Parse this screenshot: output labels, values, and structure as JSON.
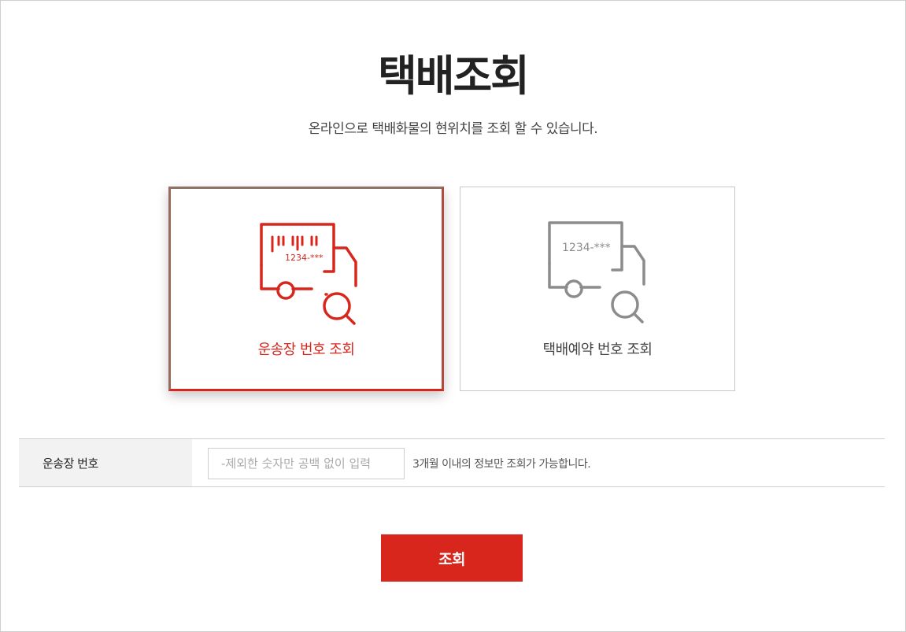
{
  "page": {
    "title": "택배조회",
    "subtitle": "온라인으로 택배화물의 현위치를 조회 할 수 있습니다."
  },
  "options": [
    {
      "label": "운송장 번호 조회",
      "icon": "truck-barcode-search-icon",
      "icon_text": "1234-***",
      "selected": true,
      "color": "#d9261c"
    },
    {
      "label": "택배예약 번호 조회",
      "icon": "truck-search-icon",
      "icon_text": "1234-***",
      "selected": false,
      "color": "#8c8c8c"
    }
  ],
  "form": {
    "label": "운송장 번호",
    "placeholder": "-제외한 숫자만 공백 없이 입력",
    "value": "",
    "note": "3개월 이내의 정보만 조회가 가능합니다."
  },
  "actions": {
    "search_label": "조회"
  },
  "colors": {
    "accent": "#d9261c",
    "muted_icon": "#8c8c8c",
    "label_bg": "#f2f2f2",
    "border": "#cfcfcf"
  }
}
